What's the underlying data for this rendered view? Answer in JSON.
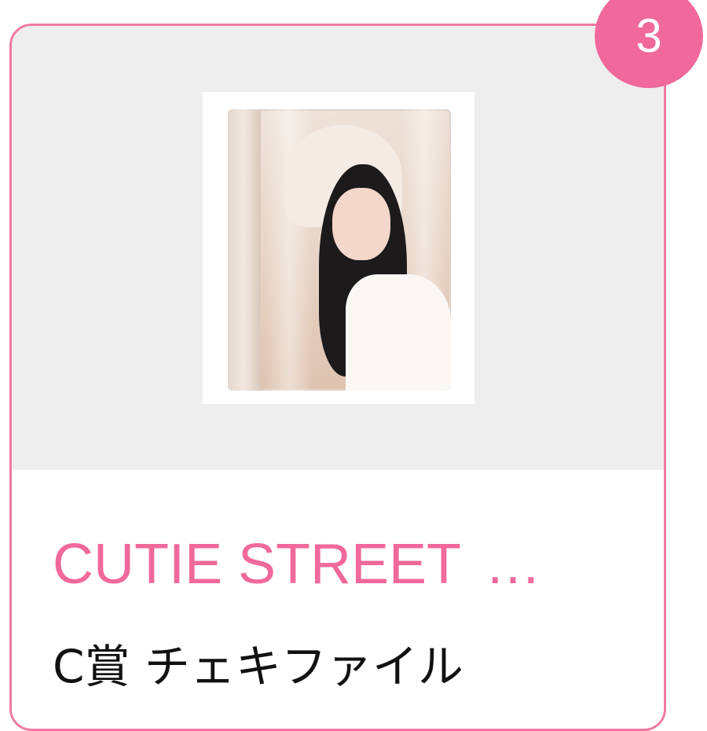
{
  "card": {
    "badge_number": "3",
    "title": "CUTIE STREET",
    "title_ellipsis": "…",
    "subtitle": "C賞 チェキファイル",
    "image": {
      "icon": "photo-binder-image"
    }
  },
  "colors": {
    "accent": "#f0699a",
    "border": "#f07aa3",
    "image_background": "#eeeeee",
    "text": "#111111"
  }
}
